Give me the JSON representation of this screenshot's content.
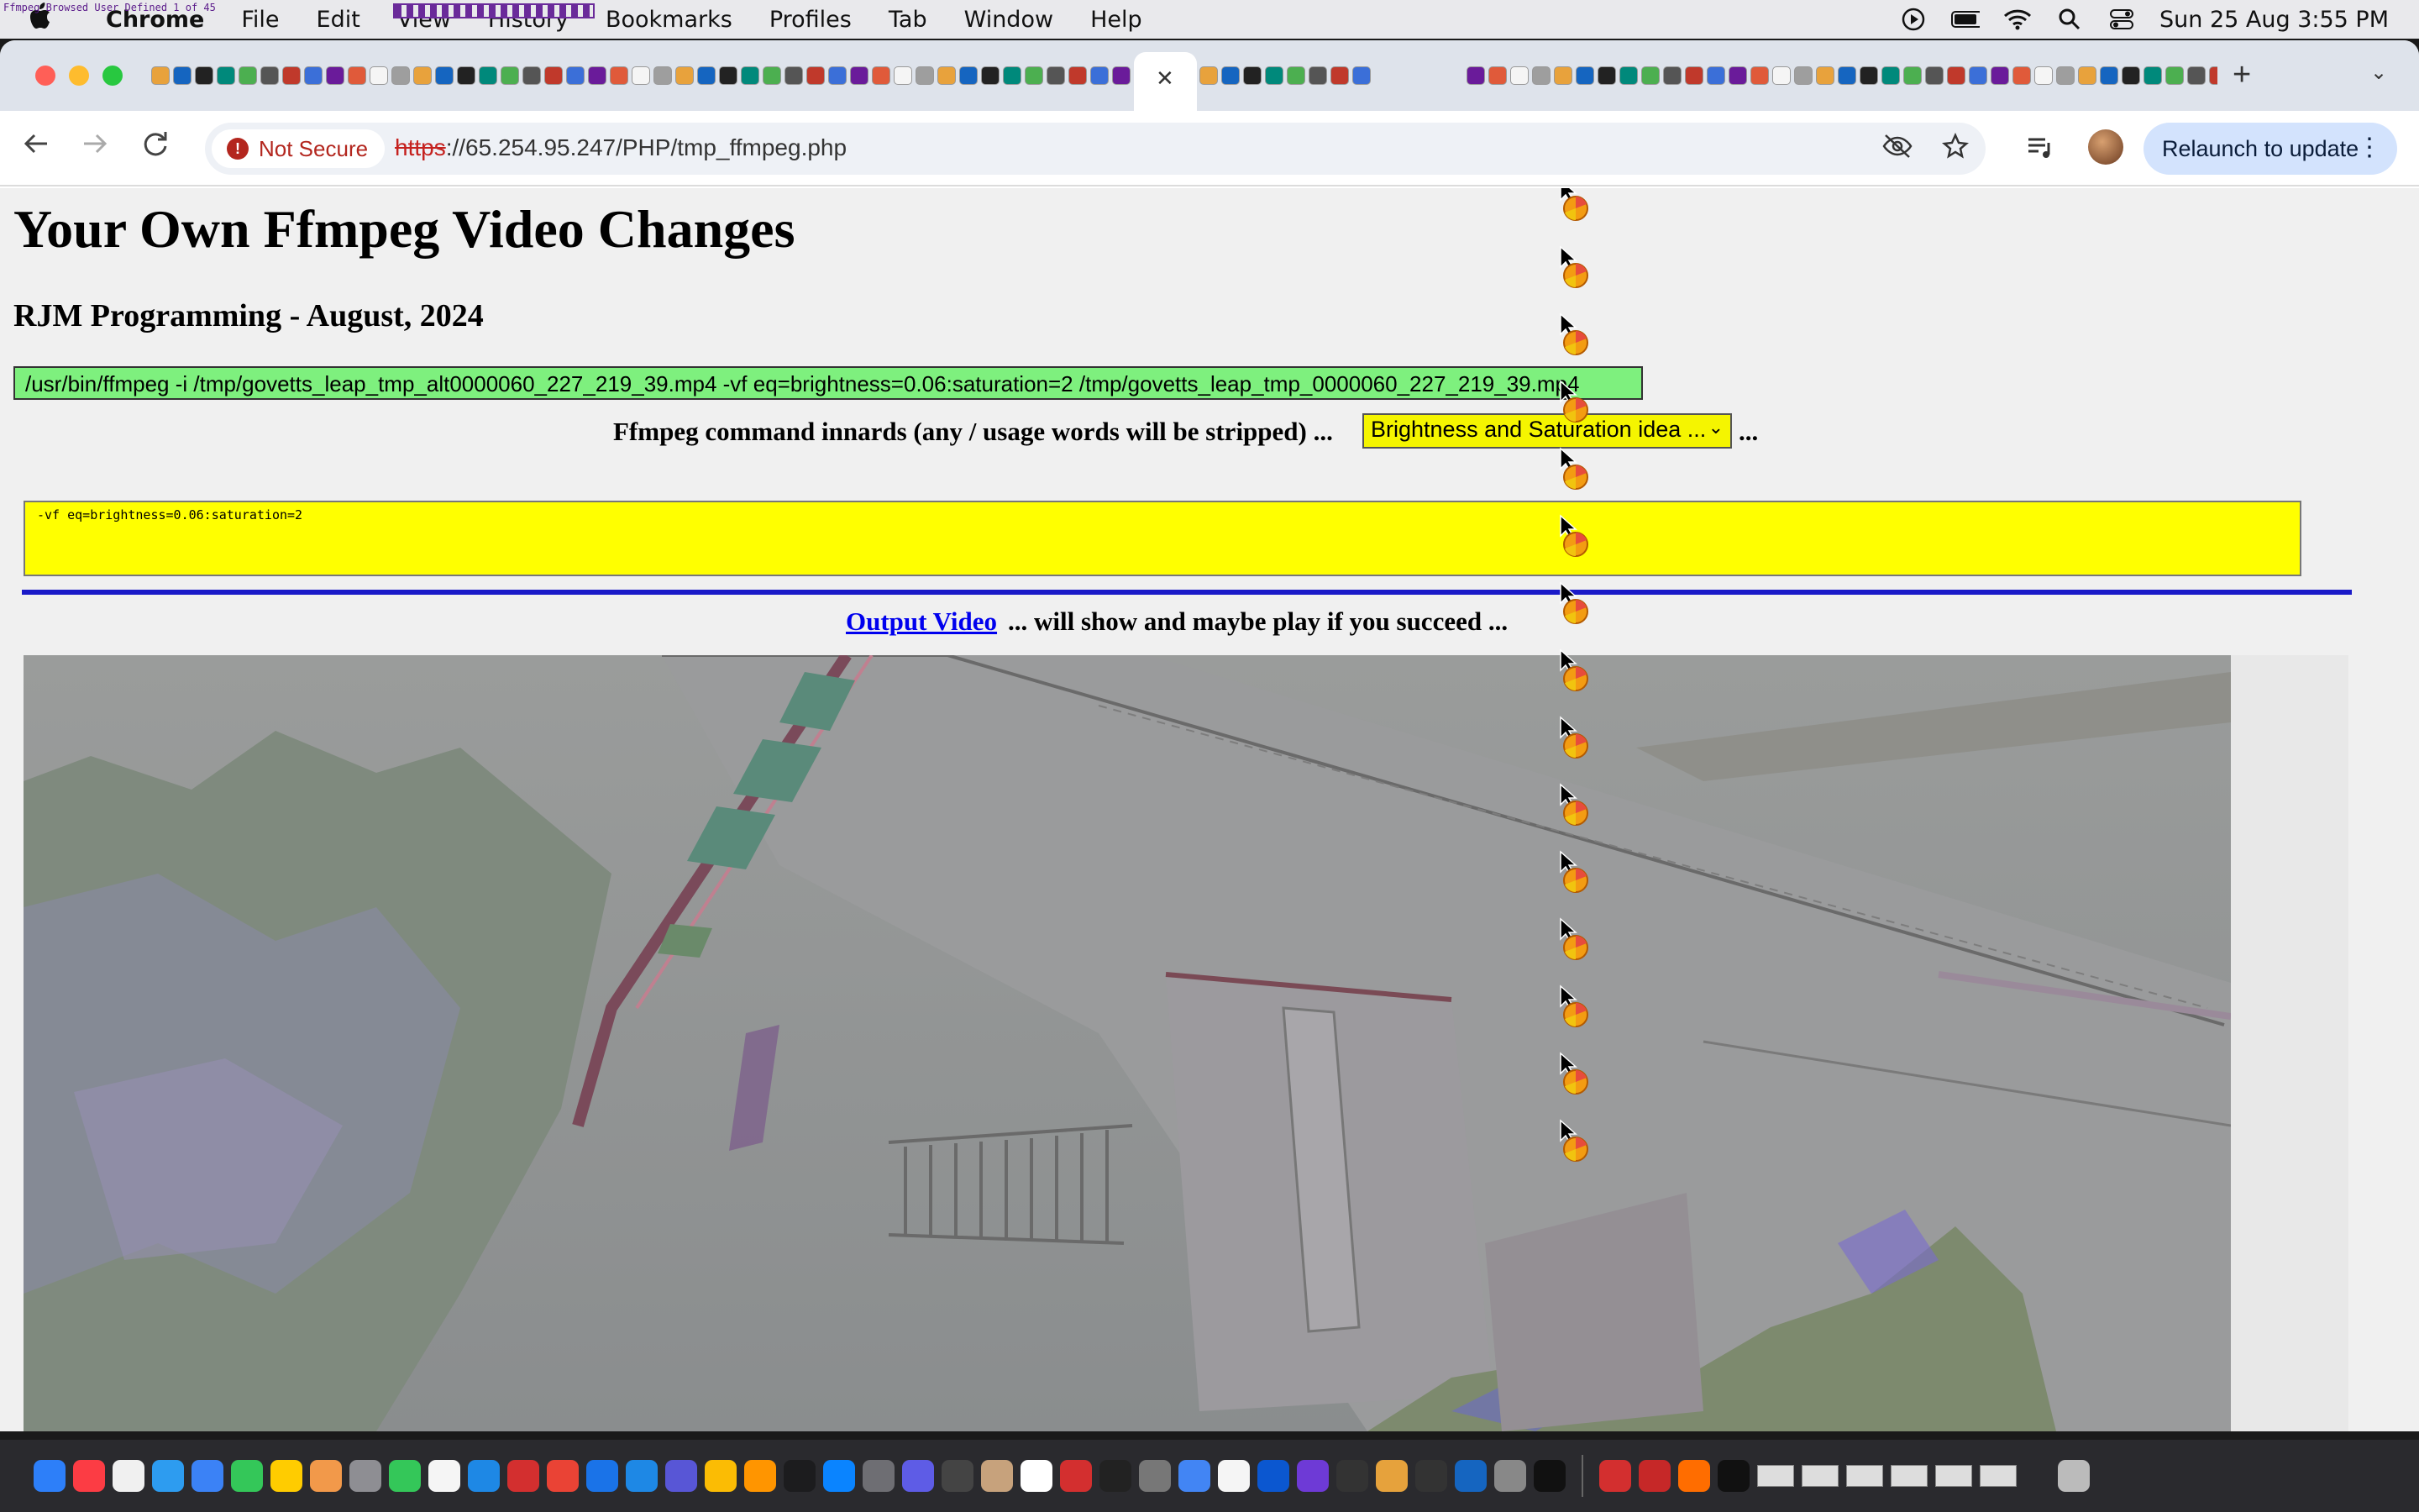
{
  "menubar": {
    "app_name": "Chrome",
    "menus": [
      "File",
      "Edit",
      "View",
      "History",
      "Bookmarks",
      "Profiles",
      "Tab",
      "Window",
      "Help"
    ],
    "overlay_label": "Ffmpeg Browsed User Defined 1 of 45",
    "clock": "Sun 25 Aug  3:55 PM"
  },
  "browser": {
    "url_scheme": "https",
    "url_rest": "://65.254.95.247/PHP/tmp_ffmpeg.php",
    "security_label": "Not Secure",
    "relaunch_label": "Relaunch to update"
  },
  "page": {
    "title": "Your Own Ffmpeg Video Changes",
    "subtitle": "RJM Programming - August, 2024",
    "command_line": "/usr/bin/ffmpeg -i /tmp/govetts_leap_tmp_alt0000060_227_219_39.mp4  -vf eq=brightness=0.06:saturation=2  /tmp/govetts_leap_tmp_0000060_227_219_39.mp4",
    "innards_label": "Ffmpeg command innards (any / usage words will be stripped) ...",
    "idea_selected": "Brightness and Saturation idea ...",
    "innards_after": "...",
    "innards_value": "-vf eq=brightness=0.06:saturation=2",
    "output_link": "Output Video",
    "output_after": "... will show and maybe play if you succeed ..."
  },
  "colors": {
    "command_bg": "#7ef07e",
    "textarea_bg": "#ffff00",
    "divider": "#1a1ac8",
    "link": "#0000ee"
  }
}
